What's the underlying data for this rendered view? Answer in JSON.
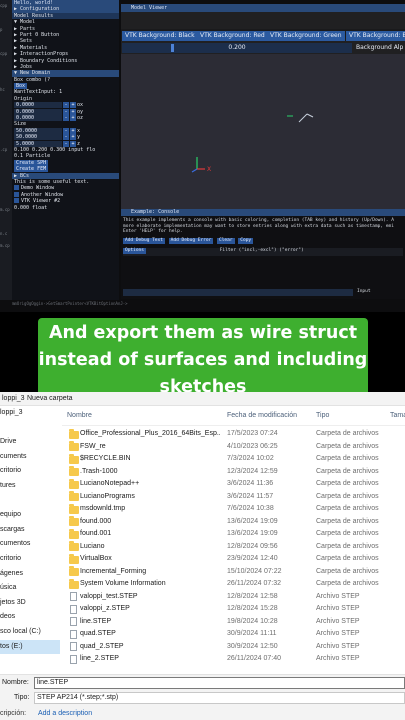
{
  "imgui": {
    "left_panel": {
      "title": "Hello, world!",
      "rows": [
        {
          "type": "hdr",
          "text": "▶ Configuration"
        },
        {
          "type": "tabs",
          "text": "Model  Results"
        },
        {
          "type": "tree",
          "text": " ▼ Model"
        },
        {
          "type": "tree",
          "text": "   ▶ Parts"
        },
        {
          "type": "tree",
          "text": "   ▶ Part 0  Button"
        },
        {
          "type": "tree",
          "text": "   ▶ Sets"
        },
        {
          "type": "tree",
          "text": "   ▶ Materials"
        },
        {
          "type": "tree",
          "text": "   ▶ InteractionProps"
        },
        {
          "type": "tree",
          "text": "   ▶ Boundary Conditions"
        },
        {
          "type": "tree",
          "text": " ▶ Jobs"
        },
        {
          "type": "hdr",
          "text": "▼ New Domain"
        },
        {
          "type": "combo",
          "text": "Box          combo (?"
        },
        {
          "type": "btn",
          "text": "Box"
        },
        {
          "type": "text",
          "text": "WantTextInput: 1"
        },
        {
          "type": "text",
          "text": "Origin"
        },
        {
          "type": "vec",
          "value": "0.0000",
          "axis": "ox"
        },
        {
          "type": "vec",
          "value": "0.0000",
          "axis": "oy"
        },
        {
          "type": "vec",
          "value": "0.0000",
          "axis": "oz"
        },
        {
          "type": "text",
          "text": "Size"
        },
        {
          "type": "vec",
          "value": "50.0000",
          "axis": "x"
        },
        {
          "type": "vec",
          "value": "50.0000",
          "axis": "y"
        },
        {
          "type": "vec",
          "value": "5.0000",
          "axis": "z"
        },
        {
          "type": "text",
          "text": "0.100  0.200  0.300  input flo"
        },
        {
          "type": "text",
          "text": "0.1                   Particle"
        },
        {
          "type": "btn",
          "text": "Create SPH"
        },
        {
          "type": "btn",
          "text": "Create FEM"
        },
        {
          "type": "hdr",
          "text": "▶ BCs"
        },
        {
          "type": "text",
          "text": "This is some useful text."
        },
        {
          "type": "check",
          "text": "Demo Window"
        },
        {
          "type": "check",
          "text": "Another Window"
        },
        {
          "type": "check",
          "text": "VTK Viewer #2"
        },
        {
          "type": "text",
          "text": "       0.000           float"
        }
      ],
      "edge_labels": [
        "cpp",
        "",
        "p",
        "",
        "cpp",
        "",
        "",
        "hc",
        "",
        "",
        "",
        "",
        ".cp",
        "",
        "",
        "",
        "",
        "m.cp",
        "",
        "n.c",
        "m.cp"
      ]
    },
    "status_line": "mmOrigOgOggin->GetSmartPointer<VTKBitOptionAnJ->",
    "model_viewer": {
      "title": "Model Viewer",
      "tabs": [
        "VTK Background: Black",
        "VTK Background: Red",
        "VTK Background: Green",
        "VTK Background: B"
      ],
      "slider_value": "0.200",
      "bg_alpha_label": "Background Alp",
      "axis_x_label": "X"
    },
    "console": {
      "title": "Example: Console",
      "description": "This example implements a console with basic coloring, completion (TAB key) and history (Up/Down). A more elaborate implementation may want to store entries along with extra data such as timestamp, emi Enter 'HELP' for help.",
      "buttons": [
        "Add Debug Text",
        "Add Debug Error",
        "Clear",
        "Copy"
      ],
      "options_label": "Options",
      "filter_label": "Filter (\"incl,-excl\") (\"error\")",
      "input_label": "Input"
    }
  },
  "caption": {
    "text": "And export them as wire struct instead of surfaces and including sketches"
  },
  "explorer": {
    "toolbar": {
      "left_label": "loppi_3",
      "new_folder": "Nueva carpeta"
    },
    "nav_items": [
      "loppi_3",
      "",
      "Drive",
      "cuments",
      "critorio",
      "tures",
      "",
      "equipo",
      "scargas",
      "cumentos",
      "critorio",
      "ágenes",
      "úsica",
      "jetos 3D",
      "deos",
      "sco local (C:)",
      "tos (E:)"
    ],
    "nav_selected_index": 16,
    "columns": {
      "name": "Nombre",
      "date": "Fecha de modificación",
      "type": "Tipo",
      "size": "Tamaño"
    },
    "files": [
      {
        "name": "Office_Professional_Plus_2016_64Bits_Esp...",
        "date": "17/5/2023 07:24",
        "type": "Carpeta de archivos",
        "kind": "folder"
      },
      {
        "name": "FSW_re",
        "date": "4/10/2023 06:25",
        "type": "Carpeta de archivos",
        "kind": "folder"
      },
      {
        "name": "$RECYCLE.BIN",
        "date": "7/3/2024 10:02",
        "type": "Carpeta de archivos",
        "kind": "folder"
      },
      {
        "name": ".Trash-1000",
        "date": "12/3/2024 12:59",
        "type": "Carpeta de archivos",
        "kind": "folder"
      },
      {
        "name": "LucianoNotepad++",
        "date": "3/6/2024 11:36",
        "type": "Carpeta de archivos",
        "kind": "folder"
      },
      {
        "name": "LucianoPrograms",
        "date": "3/6/2024 11:57",
        "type": "Carpeta de archivos",
        "kind": "folder"
      },
      {
        "name": "msdownld.tmp",
        "date": "7/6/2024 10:38",
        "type": "Carpeta de archivos",
        "kind": "folder"
      },
      {
        "name": "found.000",
        "date": "13/6/2024 19:09",
        "type": "Carpeta de archivos",
        "kind": "folder"
      },
      {
        "name": "found.001",
        "date": "13/6/2024 19:09",
        "type": "Carpeta de archivos",
        "kind": "folder"
      },
      {
        "name": "Luciano",
        "date": "12/8/2024 09:56",
        "type": "Carpeta de archivos",
        "kind": "folder"
      },
      {
        "name": "VirtualBox",
        "date": "23/9/2024 12:40",
        "type": "Carpeta de archivos",
        "kind": "folder"
      },
      {
        "name": "Incremental_Forming",
        "date": "15/10/2024 07:22",
        "type": "Carpeta de archivos",
        "kind": "folder"
      },
      {
        "name": "System Volume Information",
        "date": "26/11/2024 07:32",
        "type": "Carpeta de archivos",
        "kind": "folder"
      },
      {
        "name": "valoppi_test.STEP",
        "date": "12/8/2024 12:58",
        "type": "Archivo STEP",
        "kind": "file"
      },
      {
        "name": "valoppi_z.STEP",
        "date": "12/8/2024 15:28",
        "type": "Archivo STEP",
        "kind": "file"
      },
      {
        "name": "line.STEP",
        "date": "19/8/2024 10:28",
        "type": "Archivo STEP",
        "kind": "file"
      },
      {
        "name": "quad.STEP",
        "date": "30/9/2024 11:11",
        "type": "Archivo STEP",
        "kind": "file"
      },
      {
        "name": "quad_2.STEP",
        "date": "30/9/2024 12:50",
        "type": "Archivo STEP",
        "kind": "file"
      },
      {
        "name": "line_2.STEP",
        "date": "26/11/2024 07:40",
        "type": "Archivo STEP",
        "kind": "file"
      }
    ],
    "bottom": {
      "name_label": "Nombre:",
      "name_value": "line.STEP",
      "type_label": "Tipo:",
      "type_value": "STEP AP214 (*.step;*.stp)",
      "desc_label": "cripción:",
      "desc_link": "Add a description"
    },
    "colors": {
      "folder": "#f6c94c",
      "selection": "#cce4f7",
      "link": "#1a5fb4"
    }
  },
  "colors": {
    "caption_bg": "#3eaf2f",
    "imgui_header": "#294a7a",
    "imgui_button": "#2a5599"
  }
}
